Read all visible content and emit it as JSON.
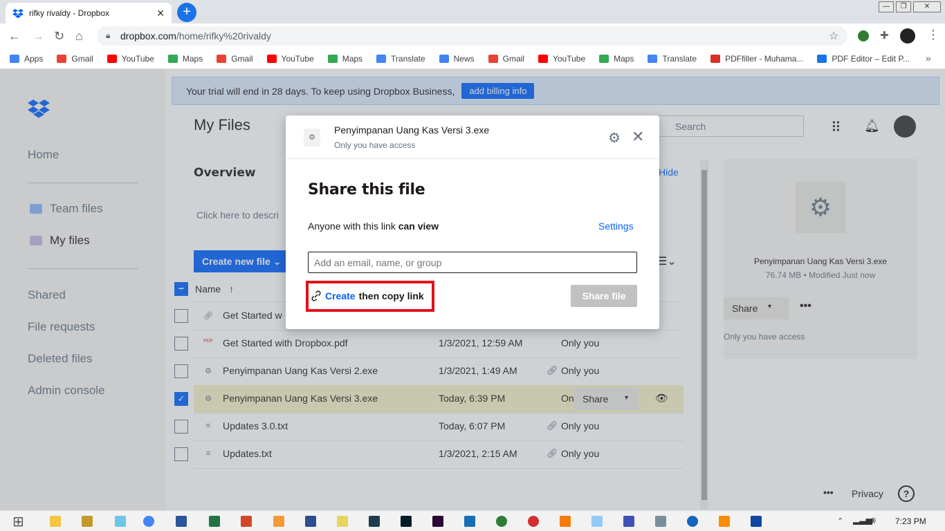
{
  "browser": {
    "tab_title": "rifky rivaldy - Dropbox",
    "url_host": "dropbox.com",
    "url_path": "/home/rifky%20rivaldy",
    "bookmarks": [
      {
        "label": "Apps",
        "color": "#4285f4"
      },
      {
        "label": "Gmail",
        "color": "#ea4335"
      },
      {
        "label": "YouTube",
        "color": "#ff0000"
      },
      {
        "label": "Maps",
        "color": "#34a853"
      },
      {
        "label": "Gmail",
        "color": "#ea4335"
      },
      {
        "label": "YouTube",
        "color": "#ff0000"
      },
      {
        "label": "Maps",
        "color": "#34a853"
      },
      {
        "label": "Translate",
        "color": "#4285f4"
      },
      {
        "label": "News",
        "color": "#4285f4"
      },
      {
        "label": "Gmail",
        "color": "#ea4335"
      },
      {
        "label": "YouTube",
        "color": "#ff0000"
      },
      {
        "label": "Maps",
        "color": "#34a853"
      },
      {
        "label": "Translate",
        "color": "#4285f4"
      },
      {
        "label": "PDFfiller - Muhama...",
        "color": "#d93025"
      },
      {
        "label": "PDF Editor – Edit P...",
        "color": "#1a73e8"
      }
    ]
  },
  "banner": {
    "text": "Your trial will end in 28 days. To keep using Dropbox Business,",
    "button": "add billing info"
  },
  "sidebar": {
    "home": "Home",
    "team_files": "Team files",
    "my_files": "My files",
    "shared": "Shared",
    "file_requests": "File requests",
    "deleted_files": "Deleted files",
    "admin_console": "Admin console"
  },
  "main": {
    "title": "My Files",
    "overview": "Overview",
    "hide": "Hide",
    "description_placeholder": "Click here to descri",
    "create_button": "Create new file",
    "search_placeholder": "Search",
    "column_name": "Name",
    "rows": [
      {
        "name": "Get Started w",
        "modified": "",
        "access": "",
        "icon": "link",
        "checked": false
      },
      {
        "name": "Get Started with Dropbox.pdf",
        "modified": "1/3/2021, 12:59 AM",
        "access": "Only you",
        "icon": "pdf",
        "checked": false
      },
      {
        "name": "Penyimpanan Uang Kas Versi 2.exe",
        "modified": "1/3/2021, 1:49 AM",
        "access": "Only you",
        "icon": "gear",
        "checked": false
      },
      {
        "name": "Penyimpanan Uang Kas Versi 3.exe",
        "modified": "Today, 6:39 PM",
        "access": "On",
        "icon": "gear",
        "checked": true
      },
      {
        "name": "Updates 3.0.txt",
        "modified": "Today, 6:07 PM",
        "access": "Only you",
        "icon": "text",
        "checked": false
      },
      {
        "name": "Updates.txt",
        "modified": "1/3/2021, 2:15 AM",
        "access": "Only you",
        "icon": "text",
        "checked": false
      }
    ],
    "row_share": "Share"
  },
  "preview": {
    "file_name": "Penyimpanan Uang Kas Versi 3.exe",
    "meta": "76.74 MB • Modified Just now",
    "share": "Share",
    "access": "Only you have access",
    "privacy": "Privacy"
  },
  "modal": {
    "file_name": "Penyimpanan Uang Kas Versi 3.exe",
    "access": "Only you have access",
    "heading": "Share this file",
    "perm_prefix": "Anyone with this link",
    "perm_value": "can view",
    "settings": "Settings",
    "input_placeholder": "Add an email, name, or group",
    "create": "Create",
    "create_suffix": "then copy link",
    "share_file": "Share file"
  },
  "taskbar": {
    "clock": "7:23 PM"
  }
}
